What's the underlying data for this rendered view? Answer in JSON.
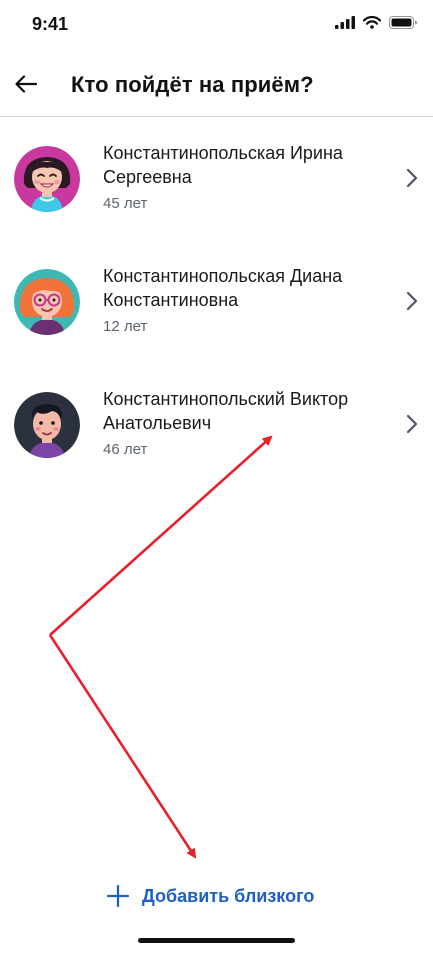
{
  "status_bar": {
    "time": "9:41"
  },
  "header": {
    "title": "Кто пойдёт на приём?"
  },
  "people": [
    {
      "name": "Константинопольская Ирина Сергеевна",
      "age": "45 лет"
    },
    {
      "name": "Константинопольская Диана Константиновна",
      "age": "12 лет"
    },
    {
      "name": "Константинопольский Виктор Анатольевич",
      "age": "46 лет"
    }
  ],
  "add_button": {
    "label": "Добавить близкого"
  },
  "colors": {
    "accent": "#1e5fc4",
    "annotation": "#e8202a"
  }
}
